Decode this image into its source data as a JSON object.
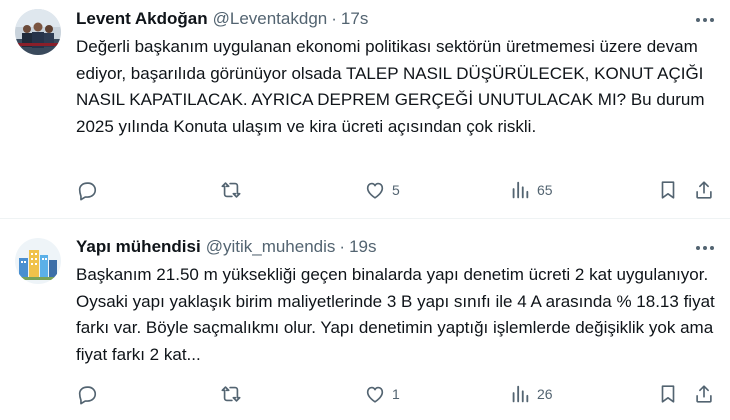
{
  "tweets": [
    {
      "author_name": "Levent Akdoğan",
      "author_handle": "@Leventakdgn",
      "separator": "·",
      "time": "17s",
      "text": "Değerli başkanım uygulanan ekonomi politikası sektörün üretmemesi üzere devam ediyor, başarılıda görünüyor olsada TALEP NASIL DÜŞÜRÜLECEK, KONUT AÇIĞI NASIL KAPATILACAK.  AYRICA DEPREM GERÇEĞİ UNUTULACAK MI? Bu durum 2025 yılında Konuta ulaşım ve kira ücreti açısından çok riskli.",
      "reply_count": "",
      "retweet_count": "",
      "like_count": "5",
      "view_count": "65",
      "icons": {
        "more": "ellipsis-icon",
        "reply": "reply-icon",
        "retweet": "retweet-icon",
        "like": "heart-icon",
        "views": "bar-chart-icon",
        "bookmark": "bookmark-icon",
        "share": "share-icon"
      }
    },
    {
      "author_name": "Yapı mühendisi",
      "author_handle": "@yitik_muhendis",
      "separator": "·",
      "time": "19s",
      "text": "Başkanım 21.50 m yüksekliği geçen binalarda yapı denetim ücreti 2 kat uygulanıyor. Oysaki yapı yaklaşık birim maliyetlerinde 3 B yapı sınıfı ile 4 A arasında % 18.13 fiyat farkı var. Böyle saçmalıkmı olur. Yapı denetimin yaptığı işlemlerde değişiklik yok ama fiyat farkı 2 kat...",
      "reply_count": "",
      "retweet_count": "",
      "like_count": "1",
      "view_count": "26",
      "icons": {
        "more": "ellipsis-icon",
        "reply": "reply-icon",
        "retweet": "retweet-icon",
        "like": "heart-icon",
        "views": "bar-chart-icon",
        "bookmark": "bookmark-icon",
        "share": "share-icon"
      }
    }
  ],
  "colors": {
    "text": "#0f1419",
    "secondary": "#536471",
    "divider": "#eff3f4",
    "background": "#ffffff"
  }
}
